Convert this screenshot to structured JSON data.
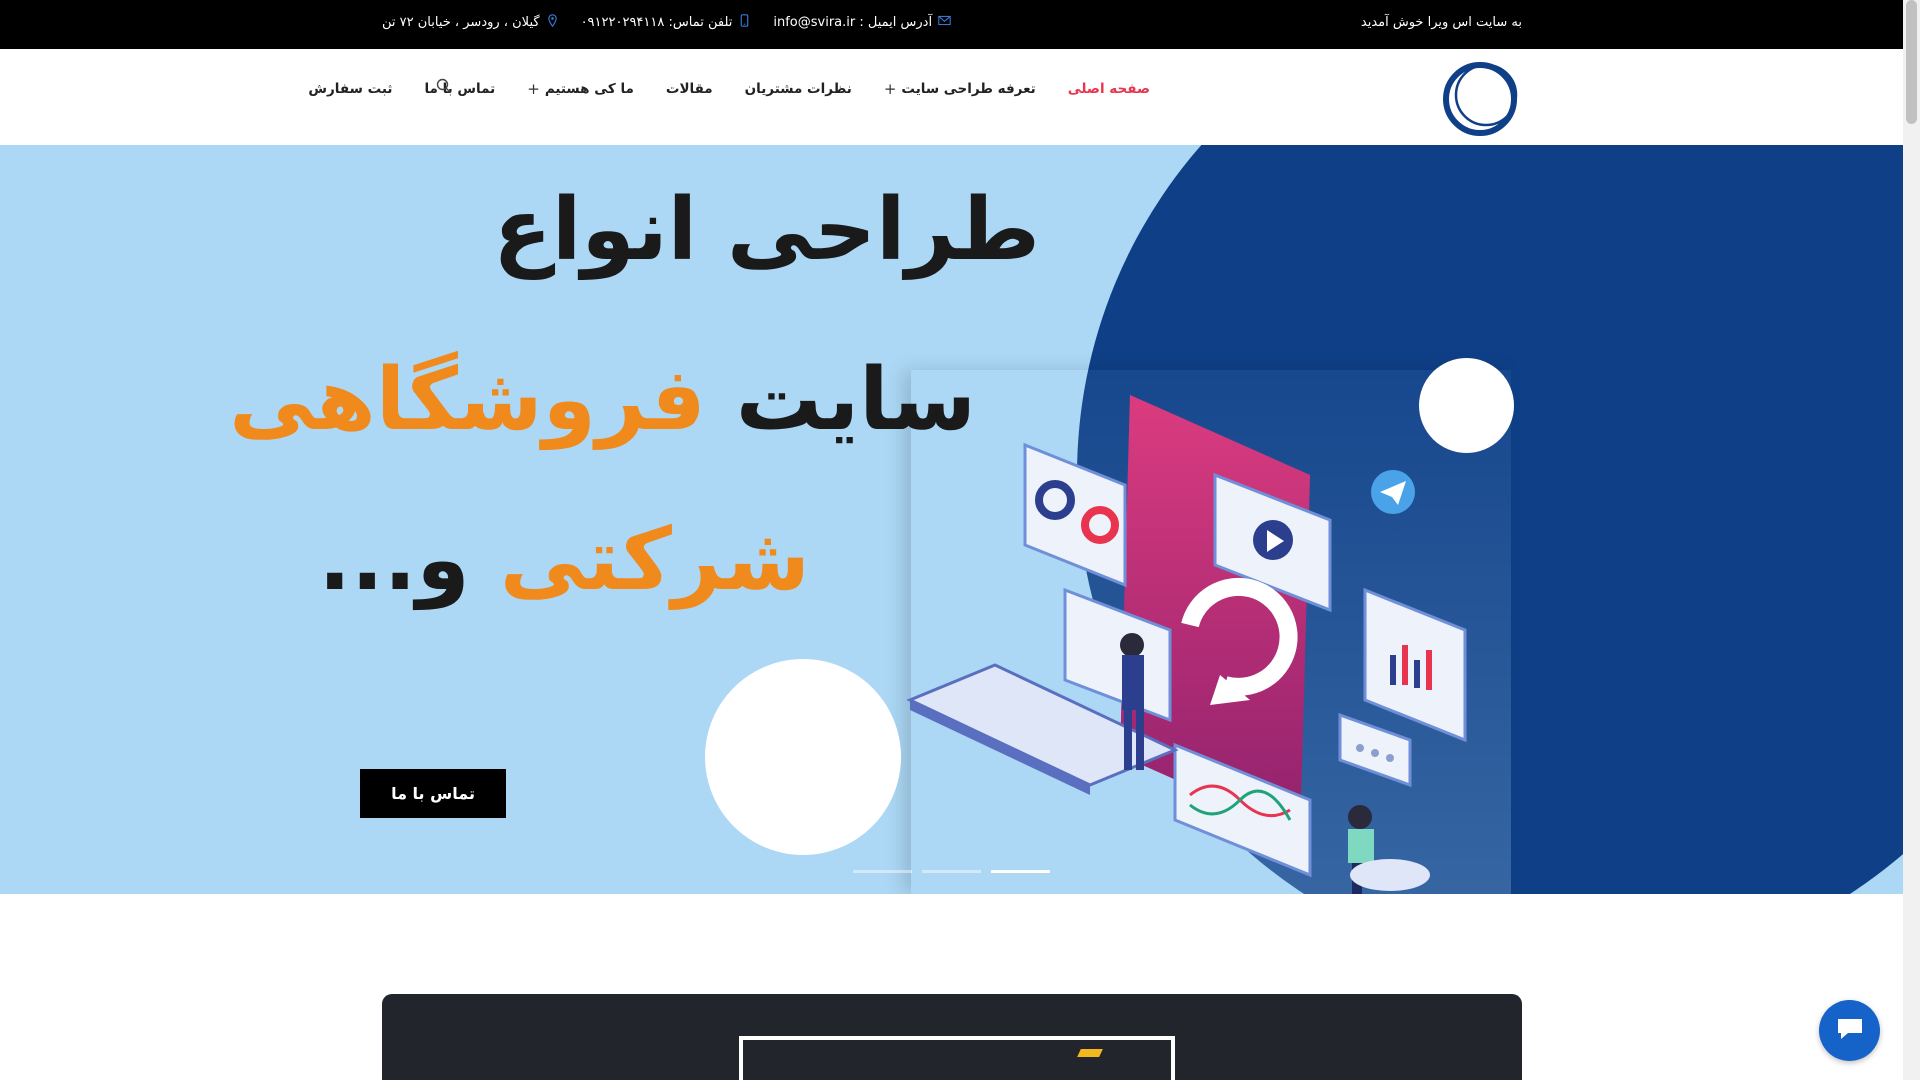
{
  "topbar": {
    "welcome": "به سایت اس ویرا خوش آمدید",
    "address": "گیلان ، رودسر ، خیابان ۷۲ تن",
    "phone": "تلفن تماس: ۰۹۱۲۲۰۲۹۴۱۱۸",
    "email": "آدرس ایمیل : info@svira.ir"
  },
  "nav": {
    "items": [
      {
        "label": "صفحه اصلی",
        "active": true
      },
      {
        "label": "تعرفه طراحی سایت",
        "has_submenu": true
      },
      {
        "label": "نظرات مشتریان"
      },
      {
        "label": "مقالات"
      },
      {
        "label": "ما کی هستیم",
        "has_submenu": true
      },
      {
        "label": "تماس با ما"
      },
      {
        "label": "ثبت سفارش"
      }
    ],
    "submenu_symbol": "+"
  },
  "hero": {
    "line1": "طراحی انواع",
    "line2_dark": "سایت",
    "line2_orange": "فروشگاهی",
    "line3_orange": "شرکتی",
    "line3_dark": "و...",
    "cta": "تماس با ما",
    "slides_total": 3,
    "active_slide": 3
  },
  "colors": {
    "topbar_bg": "#000000",
    "active_nav": "#e8344e",
    "hero_bg": "#acd8f6",
    "hero_circle": "#0f3f87",
    "accent_orange": "#f08a1c",
    "chat_button": "#1563c8"
  },
  "icons": {
    "location": "location-pin-icon",
    "phone": "mobile-phone-icon",
    "email": "envelope-icon",
    "search": "search-icon",
    "chat": "chat-bubble-icon"
  }
}
